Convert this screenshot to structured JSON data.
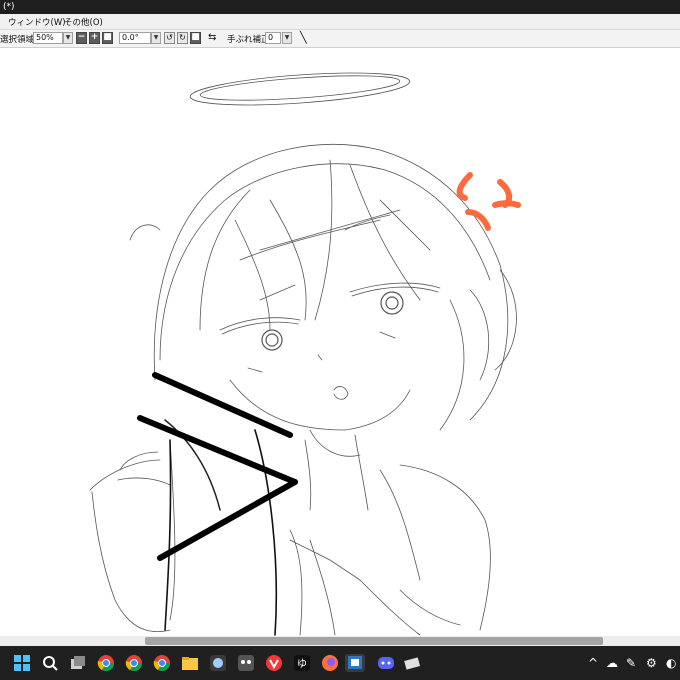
{
  "window": {
    "title": "(*)"
  },
  "menu": [
    {
      "label": "ウィンドウ(W)"
    },
    {
      "label": "その他(O)"
    }
  ],
  "toolbar": {
    "selection_label": "選択領域",
    "zoom_value": "50%",
    "rotation_value": "0.0°",
    "stabilizer_label": "手ぶれ補正",
    "stabilizer_value": "0"
  },
  "colors": {
    "anger_mark": "#ff6a3d",
    "taskbar": "#202020",
    "titlebar": "#1f1f1f"
  },
  "taskbar_icons": [
    "windows-start",
    "search",
    "task-view",
    "chrome",
    "chrome",
    "chrome",
    "file-explorer",
    "app",
    "app",
    "vivaldi",
    "yu-app",
    "firefox",
    "app",
    "discord",
    "app"
  ]
}
